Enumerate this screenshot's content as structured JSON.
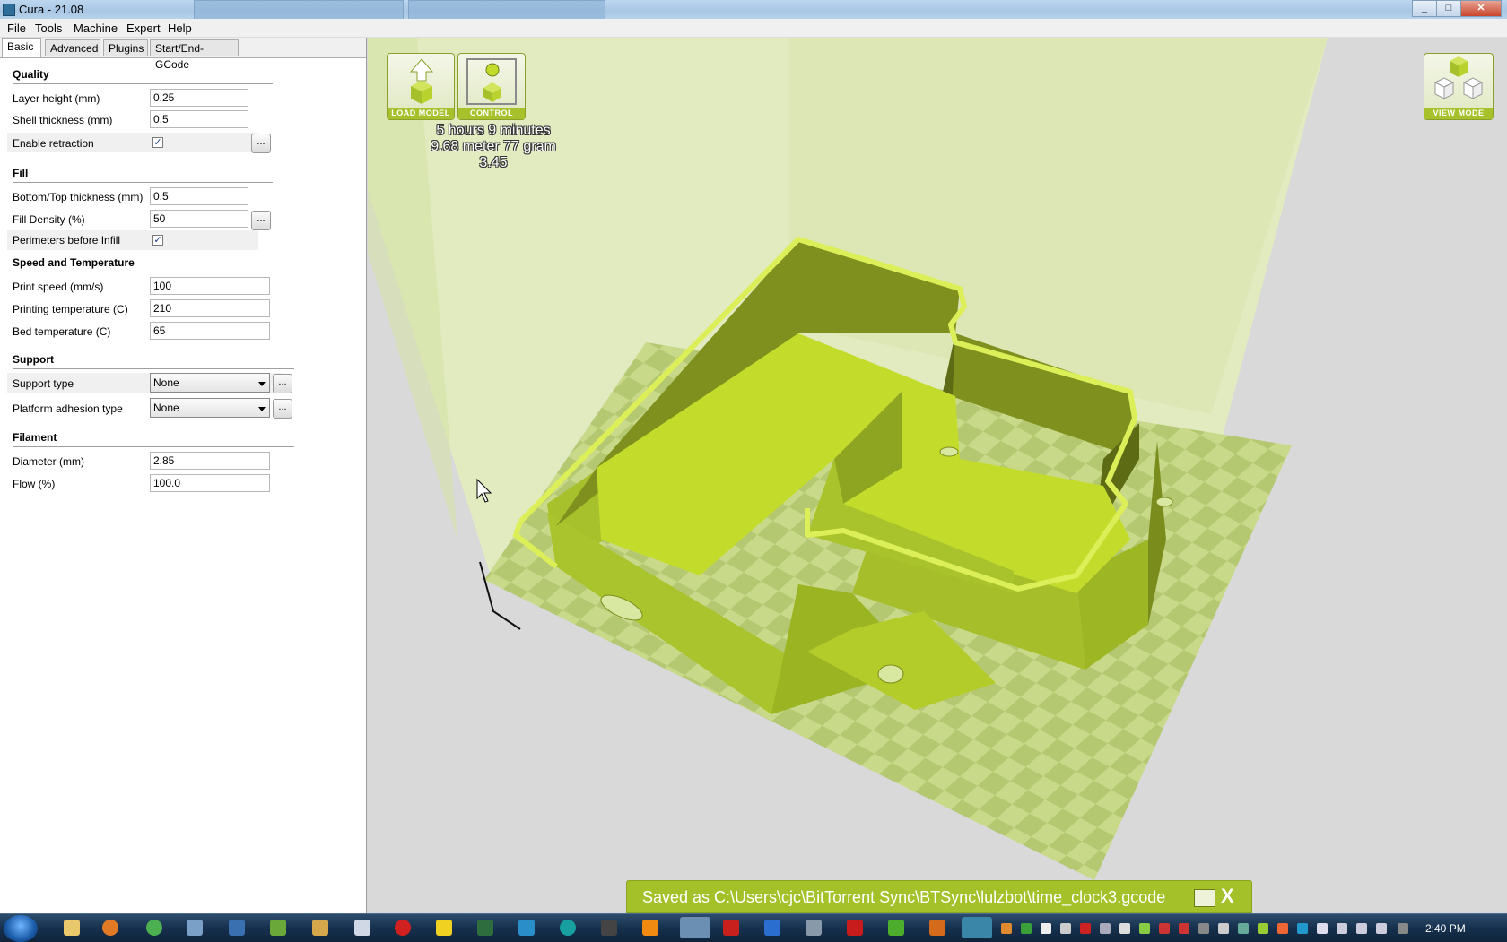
{
  "window": {
    "title": "Cura - 21.08"
  },
  "menu": [
    "File",
    "Tools",
    "Machine",
    "Expert",
    "Help"
  ],
  "tabs": [
    "Basic",
    "Advanced",
    "Plugins",
    "Start/End-GCode"
  ],
  "quality": {
    "title": "Quality",
    "layer_height_label": "Layer height (mm)",
    "layer_height": "0.25",
    "shell_label": "Shell thickness (mm)",
    "shell": "0.5",
    "retraction_label": "Enable retraction",
    "retraction": true
  },
  "fill": {
    "title": "Fill",
    "bottom_top_label": "Bottom/Top thickness (mm)",
    "bottom_top": "0.5",
    "density_label": "Fill Density (%)",
    "density": "50",
    "perimeters_label": "Perimeters before Infill",
    "perimeters": true
  },
  "speed": {
    "title": "Speed and Temperature",
    "print_speed_label": "Print speed (mm/s)",
    "print_speed": "100",
    "print_temp_label": "Printing temperature (C)",
    "print_temp": "210",
    "bed_temp_label": "Bed temperature (C)",
    "bed_temp": "65"
  },
  "support": {
    "title": "Support",
    "type_label": "Support type",
    "type": "None",
    "adhesion_label": "Platform adhesion type",
    "adhesion": "None"
  },
  "filament": {
    "title": "Filament",
    "diameter_label": "Diameter (mm)",
    "diameter": "2.85",
    "flow_label": "Flow (%)",
    "flow": "100.0"
  },
  "common": {
    "dots": "..."
  },
  "viewport": {
    "load_model": "LOAD MODEL",
    "control": "CONTROL",
    "view_mode": "VIEW MODE",
    "stats": {
      "time": "5 hours 9 minutes",
      "material": "9.68 meter 77 gram",
      "cost": "3.45"
    },
    "saved_message": "Saved as C:\\Users\\cjc\\BitTorrent Sync\\BTSync\\lulzbot\\time_clock3.gcode",
    "close": "X",
    "colors": {
      "model": "#c3dc2c",
      "model_side": "#9cb624",
      "model_dark": "#7a8c1c",
      "bed_light": "#c9d98a",
      "bed_dark": "#b3c871",
      "light_cone": "#e2ebc0"
    }
  },
  "taskbar": {
    "clock": "2:40 PM"
  }
}
